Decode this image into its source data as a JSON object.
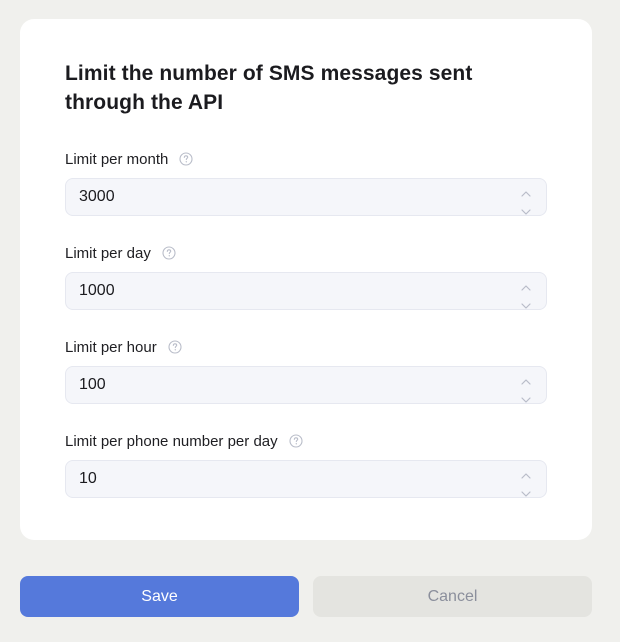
{
  "form": {
    "title": "Limit the number of SMS messages sent through the API",
    "fields": [
      {
        "label": "Limit per month",
        "value": "3000"
      },
      {
        "label": "Limit per day",
        "value": "1000"
      },
      {
        "label": "Limit per hour",
        "value": "100"
      },
      {
        "label": "Limit per phone number per day",
        "value": "10"
      }
    ]
  },
  "icons": {
    "help": "question-circle-icon",
    "increment": "chevron-up-icon",
    "decrement": "chevron-down-icon"
  },
  "actions": {
    "save_label": "Save",
    "cancel_label": "Cancel"
  },
  "colors": {
    "page_background": "#f0f0ed",
    "card_background": "#ffffff",
    "input_background": "#f5f6fa",
    "primary_button": "#5579db",
    "secondary_button": "#e4e4e0",
    "secondary_text": "#8b8f9c"
  }
}
